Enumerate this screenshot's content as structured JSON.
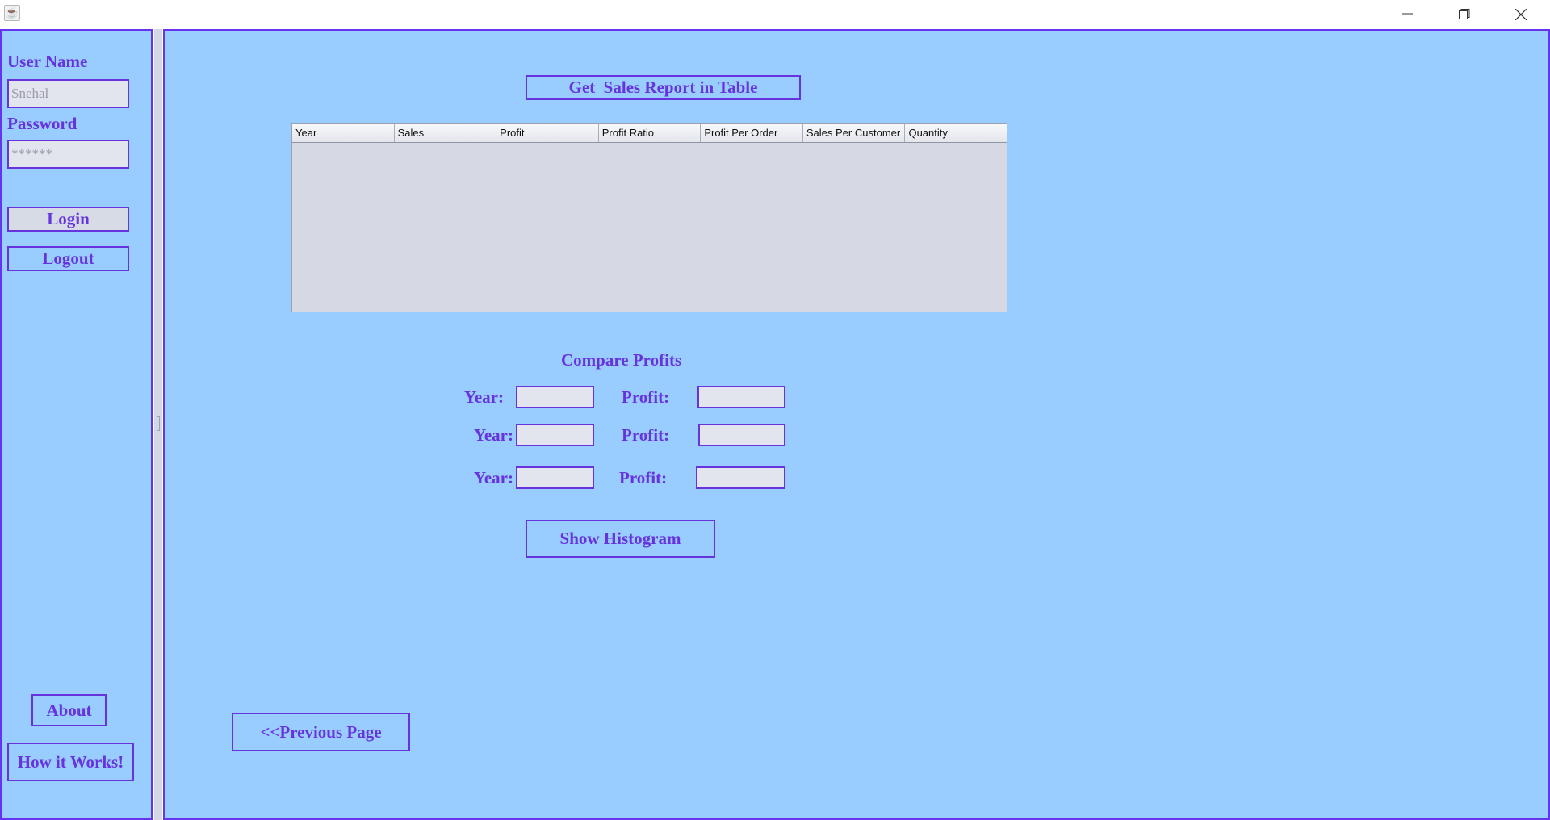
{
  "window": {
    "icon": "java-cup-icon",
    "controls": [
      "minimize-icon",
      "restore-icon",
      "close-icon"
    ]
  },
  "sidebar": {
    "username_label": "User Name",
    "username_value": "Snehal",
    "password_label": "Password",
    "password_value": "******",
    "login_label": "Login",
    "logout_label": "Logout",
    "about_label": "About",
    "how_label": "How it Works!"
  },
  "main": {
    "get_report_label": "Get  Sales Report in Table",
    "table": {
      "columns": [
        "Year",
        "Sales",
        "Profit",
        "Profit Ratio",
        "Profit Per Order",
        "Sales Per Customer",
        "Quantity"
      ],
      "rows": []
    },
    "compare": {
      "title": "Compare Profits",
      "rows": [
        {
          "year_label": "Year:",
          "year_value": "",
          "profit_label": "Profit:",
          "profit_value": ""
        },
        {
          "year_label": "Year:",
          "year_value": "",
          "profit_label": "Profit:",
          "profit_value": ""
        },
        {
          "year_label": "Year:",
          "year_value": "",
          "profit_label": "Profit:",
          "profit_value": ""
        }
      ]
    },
    "histogram_label": "Show Histogram",
    "previous_label": "<<Previous Page"
  },
  "colors": {
    "panel_bg": "#99ccff",
    "accent": "#6633dd",
    "field_bg": "#e3e5ee"
  }
}
